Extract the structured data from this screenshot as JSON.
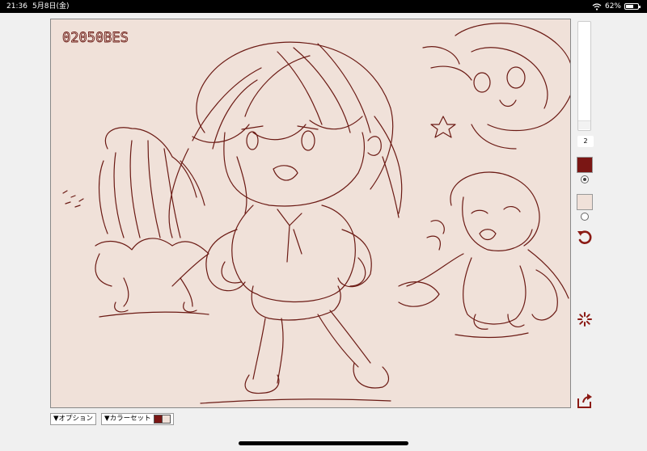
{
  "status_bar": {
    "time": "21:36",
    "date": "5月8日(金)",
    "battery": "62%",
    "battery_level": 0.62
  },
  "canvas": {
    "background_color": "#f0e1d9",
    "stroke_color": "#6b1a14",
    "corner_text": "02050BES"
  },
  "sidebar": {
    "pen_size": "2",
    "slider_position": 0.98,
    "primary_color": "#7a1614",
    "secondary_color": "#f0e1d9",
    "selected_color": "primary",
    "undo_icon": "undo-icon",
    "loading_icon": "spinner-icon",
    "share_icon": "share-icon"
  },
  "bottom": {
    "options_label": "▼オプション",
    "colorset_label": "▼カラーセット",
    "colorset_swatch_a": "#7a1614",
    "colorset_swatch_b": "#f0e1d9"
  }
}
